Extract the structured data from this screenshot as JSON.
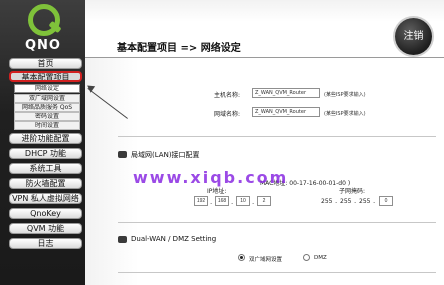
{
  "brand": {
    "logo_text": "QNO"
  },
  "sidebar": {
    "items": [
      {
        "label": "首页"
      },
      {
        "label": "基本配置项目",
        "active": true
      },
      {
        "label": "进阶功能配置"
      },
      {
        "label": "DHCP 功能"
      },
      {
        "label": "系统工具"
      },
      {
        "label": "防火墙配置"
      },
      {
        "label": "VPN 私人虚拟网络"
      },
      {
        "label": "QnoKey"
      },
      {
        "label": "QVM 功能"
      },
      {
        "label": "日志"
      }
    ],
    "subitems": [
      {
        "label": "网络设定"
      },
      {
        "label": "双广域网设置"
      },
      {
        "label": "网络品质服务 QoS"
      },
      {
        "label": "密码设置"
      },
      {
        "label": "时间设置"
      }
    ]
  },
  "header": {
    "title": "基本配置项目 => 网络设定",
    "logout_label": "注销"
  },
  "host": {
    "host_label": "主机名称:",
    "host_value": "Z_WAN_QVM_Router",
    "host_hint": "(某些ISP要求输入)",
    "domain_label": "网域名称:",
    "domain_value": "Z_WAN_QVM_Router",
    "domain_hint": "(某些ISP要求输入)"
  },
  "lan": {
    "title": "局域网(LAN)接口配置",
    "mac_text": "MAC地址: 00-17-16-00-01-d0 )",
    "ip_label": "IP地址:",
    "ip": [
      "192",
      "168",
      "10",
      "2"
    ],
    "mask_label": "子网掩码:",
    "mask_parts": [
      "255",
      "255",
      "255"
    ],
    "mask_last": "0"
  },
  "dual_wan": {
    "title": "Dual-WAN / DMZ Setting",
    "option_dual": "双广域网设置",
    "option_dmz": "DMZ",
    "selected": "dual"
  },
  "watermark": "www.xiqb.com",
  "colors": {
    "active_border": "#d22020",
    "logo_green": "#7fc23a",
    "watermark": "#8a2be2"
  }
}
